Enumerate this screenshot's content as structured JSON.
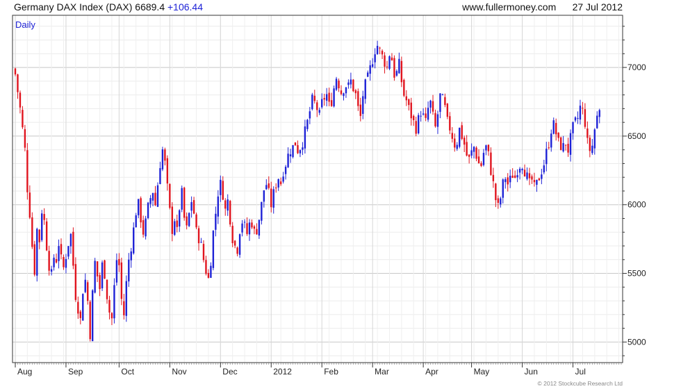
{
  "header": {
    "title": "Germany DAX Index (DAX)",
    "last": "6689.4",
    "change": "+106.44",
    "site": "www.fullermoney.com",
    "date": "27 Jul 2012"
  },
  "footer": {
    "credit": "© 2012 Stockcube Research Ltd"
  },
  "chart_data": {
    "type": "candlestick",
    "periodicity_label": "Daily",
    "colors": {
      "up": "#1e22d6",
      "down": "#e0141e",
      "grid": "#dcdcdc",
      "axis": "#333333"
    },
    "ylim": [
      4850,
      7380
    ],
    "y_ticks": [
      5000,
      5500,
      6000,
      6500,
      7000
    ],
    "x_ticks": [
      "Aug",
      "Sep",
      "Oct",
      "Nov",
      "Dec",
      "2012",
      "Feb",
      "Mar",
      "Apr",
      "May",
      "Jun",
      "Jul"
    ],
    "x_tick_index": [
      0,
      21,
      43,
      64,
      85,
      106,
      127,
      148,
      169,
      189,
      210,
      231
    ],
    "trading_days": 251,
    "close_path": [
      [
        0,
        6950
      ],
      [
        2,
        6700
      ],
      [
        4,
        6400
      ],
      [
        5,
        6120
      ],
      [
        6,
        5940
      ],
      [
        7,
        5700
      ],
      [
        8,
        5520
      ],
      [
        9,
        5820
      ],
      [
        10,
        5740
      ],
      [
        11,
        5960
      ],
      [
        12,
        5880
      ],
      [
        13,
        5700
      ],
      [
        14,
        5560
      ],
      [
        15,
        5490
      ],
      [
        16,
        5620
      ],
      [
        17,
        5600
      ],
      [
        18,
        5720
      ],
      [
        19,
        5600
      ],
      [
        20,
        5540
      ],
      [
        21,
        5630
      ],
      [
        22,
        5720
      ],
      [
        23,
        5780
      ],
      [
        24,
        5560
      ],
      [
        25,
        5340
      ],
      [
        26,
        5250
      ],
      [
        27,
        5160
      ],
      [
        28,
        5380
      ],
      [
        29,
        5450
      ],
      [
        30,
        5300
      ],
      [
        31,
        5060
      ],
      [
        32,
        5350
      ],
      [
        33,
        5580
      ],
      [
        34,
        5480
      ],
      [
        35,
        5390
      ],
      [
        36,
        5560
      ],
      [
        37,
        5500
      ],
      [
        38,
        5340
      ],
      [
        39,
        5220
      ],
      [
        40,
        5170
      ],
      [
        41,
        5400
      ],
      [
        42,
        5600
      ],
      [
        43,
        5560
      ],
      [
        44,
        5310
      ],
      [
        45,
        5200
      ],
      [
        46,
        5430
      ],
      [
        47,
        5600
      ],
      [
        48,
        5700
      ],
      [
        49,
        5820
      ],
      [
        50,
        5950
      ],
      [
        51,
        6000
      ],
      [
        52,
        5900
      ],
      [
        53,
        5800
      ],
      [
        54,
        5870
      ],
      [
        55,
        5980
      ],
      [
        56,
        6050
      ],
      [
        57,
        6100
      ],
      [
        58,
        6000
      ],
      [
        59,
        6150
      ],
      [
        60,
        6300
      ],
      [
        61,
        6400
      ],
      [
        62,
        6300
      ],
      [
        63,
        6120
      ],
      [
        64,
        5950
      ],
      [
        65,
        5820
      ],
      [
        66,
        5900
      ],
      [
        67,
        5800
      ],
      [
        68,
        5980
      ],
      [
        69,
        6080
      ],
      [
        70,
        5900
      ],
      [
        71,
        5820
      ],
      [
        72,
        5930
      ],
      [
        73,
        6030
      ],
      [
        74,
        5940
      ],
      [
        75,
        5800
      ],
      [
        76,
        5760
      ],
      [
        77,
        5700
      ],
      [
        78,
        5600
      ],
      [
        79,
        5520
      ],
      [
        80,
        5460
      ],
      [
        81,
        5600
      ],
      [
        82,
        5800
      ],
      [
        83,
        5940
      ],
      [
        84,
        6090
      ],
      [
        85,
        6150
      ],
      [
        86,
        6080
      ],
      [
        87,
        5960
      ],
      [
        88,
        6030
      ],
      [
        89,
        5900
      ],
      [
        90,
        5760
      ],
      [
        91,
        5700
      ],
      [
        92,
        5680
      ],
      [
        93,
        5820
      ],
      [
        94,
        5880
      ],
      [
        95,
        5840
      ],
      [
        96,
        5790
      ],
      [
        97,
        5860
      ],
      [
        98,
        5870
      ],
      [
        99,
        5800
      ],
      [
        100,
        5820
      ],
      [
        101,
        5900
      ],
      [
        102,
        6000
      ],
      [
        103,
        6110
      ],
      [
        104,
        6150
      ],
      [
        105,
        6080
      ],
      [
        106,
        6000
      ],
      [
        107,
        6080
      ],
      [
        108,
        6150
      ],
      [
        109,
        6200
      ],
      [
        110,
        6160
      ],
      [
        111,
        6250
      ],
      [
        112,
        6300
      ],
      [
        113,
        6360
      ],
      [
        114,
        6400
      ],
      [
        115,
        6420
      ],
      [
        116,
        6450
      ],
      [
        117,
        6400
      ],
      [
        118,
        6420
      ],
      [
        119,
        6460
      ],
      [
        120,
        6530
      ],
      [
        121,
        6600
      ],
      [
        122,
        6680
      ],
      [
        123,
        6760
      ],
      [
        124,
        6740
      ],
      [
        125,
        6700
      ],
      [
        126,
        6650
      ],
      [
        127,
        6740
      ],
      [
        128,
        6780
      ],
      [
        129,
        6800
      ],
      [
        130,
        6720
      ],
      [
        131,
        6760
      ],
      [
        132,
        6850
      ],
      [
        133,
        6930
      ],
      [
        134,
        6880
      ],
      [
        135,
        6820
      ],
      [
        136,
        6850
      ],
      [
        137,
        6870
      ],
      [
        138,
        6860
      ],
      [
        139,
        6900
      ],
      [
        140,
        6850
      ],
      [
        141,
        6800
      ],
      [
        142,
        6700
      ],
      [
        143,
        6640
      ],
      [
        144,
        6800
      ],
      [
        145,
        6870
      ],
      [
        146,
        6920
      ],
      [
        147,
        6990
      ],
      [
        148,
        7060
      ],
      [
        149,
        7130
      ],
      [
        150,
        7160
      ],
      [
        151,
        7120
      ],
      [
        152,
        7080
      ],
      [
        153,
        7040
      ],
      [
        154,
        7000
      ],
      [
        155,
        7100
      ],
      [
        156,
        7060
      ],
      [
        157,
        6950
      ],
      [
        158,
        6960
      ],
      [
        159,
        7020
      ],
      [
        160,
        6900
      ],
      [
        161,
        6800
      ],
      [
        162,
        6760
      ],
      [
        163,
        6700
      ],
      [
        164,
        6650
      ],
      [
        165,
        6600
      ],
      [
        166,
        6560
      ],
      [
        167,
        6620
      ],
      [
        168,
        6680
      ],
      [
        169,
        6640
      ],
      [
        170,
        6600
      ],
      [
        171,
        6700
      ],
      [
        172,
        6740
      ],
      [
        173,
        6640
      ],
      [
        174,
        6560
      ],
      [
        175,
        6660
      ],
      [
        176,
        6790
      ],
      [
        177,
        6760
      ],
      [
        178,
        6700
      ],
      [
        179,
        6600
      ],
      [
        180,
        6560
      ],
      [
        181,
        6500
      ],
      [
        182,
        6440
      ],
      [
        183,
        6460
      ],
      [
        184,
        6550
      ],
      [
        185,
        6500
      ],
      [
        186,
        6440
      ],
      [
        187,
        6360
      ],
      [
        188,
        6330
      ],
      [
        189,
        6380
      ],
      [
        190,
        6420
      ],
      [
        191,
        6360
      ],
      [
        192,
        6300
      ],
      [
        193,
        6290
      ],
      [
        194,
        6380
      ],
      [
        195,
        6420
      ],
      [
        196,
        6360
      ],
      [
        197,
        6250
      ],
      [
        198,
        6150
      ],
      [
        199,
        6040
      ],
      [
        200,
        5980
      ],
      [
        201,
        6050
      ],
      [
        202,
        6150
      ],
      [
        203,
        6200
      ],
      [
        204,
        6150
      ],
      [
        205,
        6180
      ],
      [
        206,
        6220
      ],
      [
        207,
        6200
      ],
      [
        208,
        6260
      ],
      [
        209,
        6290
      ],
      [
        210,
        6300
      ],
      [
        211,
        6250
      ],
      [
        212,
        6200
      ],
      [
        213,
        6150
      ],
      [
        214,
        6180
      ],
      [
        215,
        6120
      ],
      [
        216,
        6150
      ],
      [
        217,
        6200
      ],
      [
        218,
        6250
      ],
      [
        219,
        6300
      ],
      [
        220,
        6380
      ],
      [
        221,
        6450
      ],
      [
        222,
        6550
      ],
      [
        223,
        6580
      ],
      [
        224,
        6520
      ],
      [
        225,
        6450
      ],
      [
        226,
        6430
      ],
      [
        227,
        6420
      ],
      [
        228,
        6450
      ],
      [
        229,
        6400
      ],
      [
        230,
        6480
      ],
      [
        231,
        6560
      ],
      [
        232,
        6600
      ],
      [
        233,
        6630
      ],
      [
        234,
        6710
      ],
      [
        235,
        6680
      ],
      [
        236,
        6600
      ],
      [
        237,
        6450
      ],
      [
        238,
        6400
      ],
      [
        239,
        6430
      ],
      [
        240,
        6550
      ],
      [
        241,
        6640
      ],
      [
        242,
        6689.4
      ]
    ]
  }
}
